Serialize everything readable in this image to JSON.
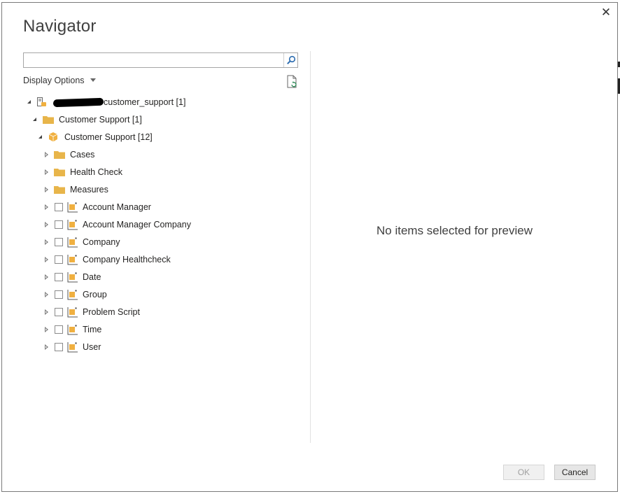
{
  "dialog": {
    "title": "Navigator",
    "close_glyph": "✕"
  },
  "search": {
    "value": "",
    "placeholder": "",
    "icon": "search-icon"
  },
  "toolbar": {
    "display_options_label": "Display Options",
    "refresh_icon": "refresh-icon"
  },
  "tree": {
    "root": {
      "label": "customer_support [1]",
      "icon": "database-server-icon",
      "expanded": true
    },
    "folder": {
      "label": "Customer Support [1]",
      "icon": "folder-icon",
      "expanded": true
    },
    "cube": {
      "label": "Customer Support [12]",
      "icon": "cube-icon",
      "expanded": true
    },
    "folders": [
      {
        "label": "Cases",
        "icon": "folder-icon"
      },
      {
        "label": "Health Check",
        "icon": "folder-icon"
      },
      {
        "label": "Measures",
        "icon": "folder-icon"
      }
    ],
    "dimensions": [
      {
        "label": "Account Manager",
        "icon": "dimension-icon",
        "checked": false
      },
      {
        "label": "Account Manager Company",
        "icon": "dimension-icon",
        "checked": false
      },
      {
        "label": "Company",
        "icon": "dimension-icon",
        "checked": false
      },
      {
        "label": "Company Healthcheck",
        "icon": "dimension-icon",
        "checked": false
      },
      {
        "label": "Date",
        "icon": "dimension-icon",
        "checked": false
      },
      {
        "label": "Group",
        "icon": "dimension-icon",
        "checked": false
      },
      {
        "label": "Problem Script",
        "icon": "dimension-icon",
        "checked": false
      },
      {
        "label": "Time",
        "icon": "dimension-icon",
        "checked": false
      },
      {
        "label": "User",
        "icon": "dimension-icon",
        "checked": false
      }
    ]
  },
  "preview": {
    "empty_message": "No items selected for preview"
  },
  "footer": {
    "ok_label": "OK",
    "cancel_label": "Cancel",
    "ok_enabled": false
  },
  "colors": {
    "folder": "#e8b54a",
    "cube": "#f0b040",
    "accent": "#2b6cb0"
  }
}
